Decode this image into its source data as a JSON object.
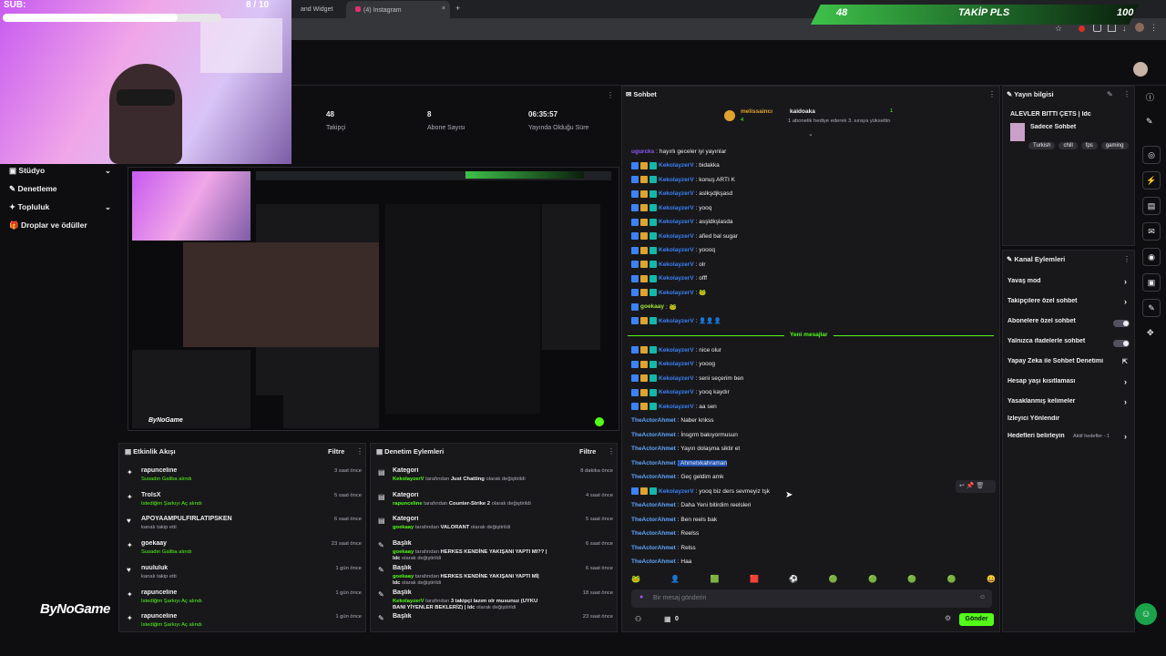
{
  "browser": {
    "tabs": [
      "and Widget",
      "(4) Instagram"
    ],
    "new_tab": "+"
  },
  "overlay": {
    "sub_label": "SUB:",
    "sub_count": "8 / 10",
    "sub_progress": 0.8,
    "follow_left": "48",
    "follow_title": "TAKİP PLS",
    "follow_right": "100",
    "follow_progress": 0.48
  },
  "stats": [
    {
      "value": "48",
      "label": "Takipçi"
    },
    {
      "value": "8",
      "label": "Abone Sayısı"
    },
    {
      "value": "06:35:57",
      "label": "Yayında Olduğu Süre"
    }
  ],
  "leftnav": [
    {
      "label": "Stüdyo",
      "icon": "studio-icon"
    },
    {
      "label": "Denetleme",
      "icon": "wrench-icon"
    },
    {
      "label": "Topluluk",
      "icon": "community-icon"
    },
    {
      "label": "Droplar ve ödüller",
      "icon": "gift-icon"
    }
  ],
  "preview": {
    "brand": "ByNoGame"
  },
  "activity": {
    "title": "Etkinlik Akışı",
    "filter": "Filtre",
    "items": [
      {
        "name": "rapunceline",
        "sub": "Susadın Galiba alındı",
        "time": "3 saat önce"
      },
      {
        "name": "TrolsX",
        "sub": "İstediğim Şarkıyı Aç alındı",
        "time": "5 saat önce"
      },
      {
        "name": "APOYAAMPULFIRLATIPSKEN",
        "sub": "kanalı takip etti",
        "time": "6 saat önce"
      },
      {
        "name": "goekaay",
        "sub": "Susadın Galiba alındı",
        "time": "23 saat önce"
      },
      {
        "name": "nuululuk",
        "sub": "kanalı takip etti",
        "time": "1 gün önce"
      },
      {
        "name": "rapunceline",
        "sub": "İstediğim Şarkıyı Aç alındı",
        "time": "1 gün önce"
      },
      {
        "name": "rapunceline",
        "sub": "İstediğim Şarkıyı Aç alındı",
        "time": "1 gün önce"
      }
    ]
  },
  "mod": {
    "title": "Denetim Eylemleri",
    "filter": "Filtre",
    "items": [
      {
        "kind": "Kategori",
        "user": "KekolayzerV",
        "text1": " tarafından ",
        "hl": "Just Chatting",
        "text2": " olarak değiştirildi",
        "time": "8 dakika önce"
      },
      {
        "kind": "Kategori",
        "user": "rapunceline",
        "text1": " tarafından ",
        "hl": "Counter-Strike 2",
        "text2": " olarak değiştirildi",
        "time": "4 saat önce"
      },
      {
        "kind": "Kategori",
        "user": "goekaay",
        "text1": " tarafından ",
        "hl": "VALORANT",
        "text2": " olarak değiştirildi",
        "time": "5 saat önce"
      },
      {
        "kind": "Başlık",
        "user": "goekaay",
        "text1": " tarafından ",
        "hl": "HERKES KENDİNE YAKIŞANI YAPTI MI?? | Idc",
        "text2": " olarak değiştirildi",
        "time": "6 saat önce"
      },
      {
        "kind": "Başlık",
        "user": "goekaay",
        "text1": " tarafından ",
        "hl": "HERKES KENDİNE YAKIŞANI YAPTI Mİ| Idc",
        "text2": " olarak değiştirildi",
        "time": "6 saat önce"
      },
      {
        "kind": "Başlık",
        "user": "KekolayzerV",
        "text1": " tarafından ",
        "hl": "3 takipçi lazım olr musunuz (UYKU BANI YİYENLER BEKLERİZ) | Idc",
        "text2": " olarak değiştirildi",
        "time": "18 saat önce"
      },
      {
        "kind": "Başlık",
        "user": "",
        "text1": "",
        "hl": "",
        "text2": "",
        "time": "23 saat önce"
      }
    ]
  },
  "chat": {
    "title": "Sohbet",
    "pin1_user": "melissaincı",
    "pin1_count": "4",
    "pin2_user": "kaidoaka",
    "pin2_note": "1 abonelik hediye ederek 3. sıraya yükseltin",
    "pin2_count": "1",
    "new_msgs": "Yeni mesajlar",
    "messages": [
      {
        "user": "ugurcks",
        "text": ": hayırlı geceler iyi yayınlar",
        "badges": 0,
        "color": "#8b5cf6"
      },
      {
        "user": "KekolayzerV",
        "text": ": bidakka",
        "badges": 3,
        "color": "#3b82f6"
      },
      {
        "user": "KekolayzerV",
        "text": ": konuş ARTI K",
        "badges": 3,
        "color": "#3b82f6"
      },
      {
        "user": "KekolayzerV",
        "text": ": aslkşdjkşasd",
        "badges": 3,
        "color": "#3b82f6"
      },
      {
        "user": "KekolayzerV",
        "text": ": yooq",
        "badges": 3,
        "color": "#3b82f6"
      },
      {
        "user": "KekolayzerV",
        "text": ": asşldkşlasda",
        "badges": 3,
        "color": "#3b82f6"
      },
      {
        "user": "KekolayzerV",
        "text": ": afied bal sugar",
        "badges": 3,
        "color": "#3b82f6"
      },
      {
        "user": "KekolayzerV",
        "text": ": yoooq",
        "badges": 3,
        "color": "#3b82f6"
      },
      {
        "user": "KekolayzerV",
        "text": ": olr",
        "badges": 3,
        "color": "#3b82f6"
      },
      {
        "user": "KekolayzerV",
        "text": ": offf",
        "badges": 3,
        "color": "#3b82f6"
      },
      {
        "user": "KekolayzerV",
        "text": ": 🐸",
        "badges": 3,
        "color": "#3b82f6"
      },
      {
        "user": "goekaay",
        "text": ": 🐸",
        "badges": 1,
        "color": "#a3e635"
      },
      {
        "user": "KekolayzerV",
        "text": ": 👤👤👤",
        "badges": 3,
        "color": "#3b82f6"
      }
    ],
    "messages2": [
      {
        "user": "KekolayzerV",
        "text": ": nice olur",
        "badges": 3,
        "color": "#3b82f6"
      },
      {
        "user": "KekolayzerV",
        "text": ": yooog",
        "badges": 3,
        "color": "#3b82f6"
      },
      {
        "user": "KekolayzerV",
        "text": ": seni seçerim ben",
        "badges": 3,
        "color": "#3b82f6"
      },
      {
        "user": "KekolayzerV",
        "text": ": yooq kaydır",
        "badges": 3,
        "color": "#3b82f6"
      },
      {
        "user": "KekolayzerV",
        "text": ": aa sen",
        "badges": 3,
        "color": "#3b82f6"
      },
      {
        "user": "TheActorAhmet",
        "text": ": Naber knkss",
        "badges": 0,
        "color": "#60a5fa"
      },
      {
        "user": "TheActorAhmet",
        "text": ": İnsgrm bakıyormusun",
        "badges": 0,
        "color": "#60a5fa"
      },
      {
        "user": "TheActorAhmet",
        "text": ": Yayın dolaşma siktir et",
        "badges": 0,
        "color": "#60a5fa"
      },
      {
        "user": "TheActorAhmet",
        "text": ": Ahmetxkahraman",
        "badges": 0,
        "color": "#60a5fa"
      },
      {
        "user": "TheActorAhmet",
        "text": ": Geç geldim amk",
        "badges": 0,
        "color": "#60a5fa"
      },
      {
        "user": "KekolayzerV",
        "text": ": yooq biz ders sevmeyiz tşk",
        "badges": 3,
        "color": "#3b82f6"
      },
      {
        "user": "TheActorAhmet",
        "text": ": Daha Yeni bitirdim reelsleri",
        "badges": 0,
        "color": "#60a5fa"
      },
      {
        "user": "TheActorAhmet",
        "text": ": Ben reels bak",
        "badges": 0,
        "color": "#60a5fa"
      },
      {
        "user": "TheActorAhmet",
        "text": ": Reelss",
        "badges": 0,
        "color": "#60a5fa"
      },
      {
        "user": "TheActorAhmet",
        "text": ": Relss",
        "badges": 0,
        "color": "#60a5fa"
      },
      {
        "user": "TheActorAhmet",
        "text": ": Haa",
        "badges": 0,
        "color": "#60a5fa"
      }
    ],
    "input_placeholder": "Bir mesaj gönderin",
    "send": "Gönder",
    "count": "0"
  },
  "streaminfo": {
    "title": "Yayın bilgisi",
    "stream_title": "ALEVLER BİTTİ ÇETS | Idc",
    "category": "Sadece Sohbet",
    "tags": [
      "Turkish",
      "chill",
      "fps",
      "gaming"
    ]
  },
  "channel": {
    "title": "Kanal Eylemleri",
    "rows": [
      {
        "label": "Yavaş mod",
        "ctrl": "chevron"
      },
      {
        "label": "Takipçilere özel sohbet",
        "ctrl": "chevron"
      },
      {
        "label": "Abonelere özel sohbet",
        "ctrl": "toggle"
      },
      {
        "label": "Yalnızca ifadelerle sohbet",
        "ctrl": "toggle"
      },
      {
        "label": "Yapay Zeka ile Sohbet Denetimi",
        "ctrl": "external"
      },
      {
        "label": "Hesap yaşı kısıtlaması",
        "ctrl": "chevron"
      },
      {
        "label": "Yasaklanmış kelimeler",
        "ctrl": "chevron"
      },
      {
        "label": "İzleyici Yönlendir",
        "ctrl": "none"
      },
      {
        "label": "Hedefleri belirleyin",
        "ctrl": "chevron"
      }
    ],
    "goal_note": "Aktif hedefler - 1"
  },
  "colors": {
    "accent": "#53fc18",
    "panel": "#18181b",
    "bg": "#0e0e10"
  }
}
